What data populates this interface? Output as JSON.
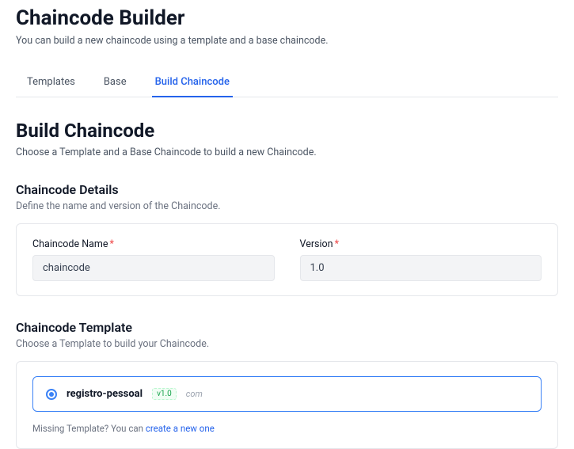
{
  "header": {
    "title": "Chaincode Builder",
    "subtitle": "You can build a new chaincode using a template and a base chaincode."
  },
  "tabs": {
    "templates": "Templates",
    "base": "Base",
    "build": "Build Chaincode"
  },
  "build": {
    "heading": "Build Chaincode",
    "subtext": "Choose a Template and a Base Chaincode to build a new Chaincode."
  },
  "details": {
    "heading": "Chaincode Details",
    "subtext": "Define the name and version of the Chaincode.",
    "name_label": "Chaincode Name",
    "name_value": "chaincode",
    "version_label": "Version",
    "version_value": "1.0"
  },
  "template": {
    "heading": "Chaincode Template",
    "subtext": "Choose a Template to build your Chaincode.",
    "item": {
      "name": "registro-pessoal",
      "version": "v1.0",
      "desc": "com"
    },
    "missing_prefix": "Missing Template? You can ",
    "missing_link": "create a new one"
  }
}
